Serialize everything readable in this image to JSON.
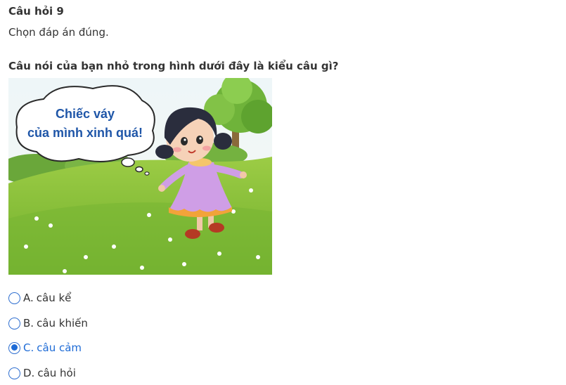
{
  "question": {
    "title": "Câu hỏi 9",
    "instruction": "Chọn đáp án đúng.",
    "stem": "Câu nói của bạn nhỏ trong hình dưới đây là kiểu câu gì?"
  },
  "image": {
    "bubble_line1": "Chiếc váy",
    "bubble_line2": "của mình xinh quá!"
  },
  "options": [
    {
      "letter": "A.",
      "text": "câu kể",
      "selected": false
    },
    {
      "letter": "B.",
      "text": "câu khiến",
      "selected": false
    },
    {
      "letter": "C.",
      "text": "câu cảm",
      "selected": true
    },
    {
      "letter": "D.",
      "text": "câu hỏi",
      "selected": false
    }
  ],
  "colors": {
    "selected": "#1e6bd6",
    "text": "#333333",
    "radio_border": "#2f6fd0",
    "bubble_text": "#1f56a8"
  }
}
